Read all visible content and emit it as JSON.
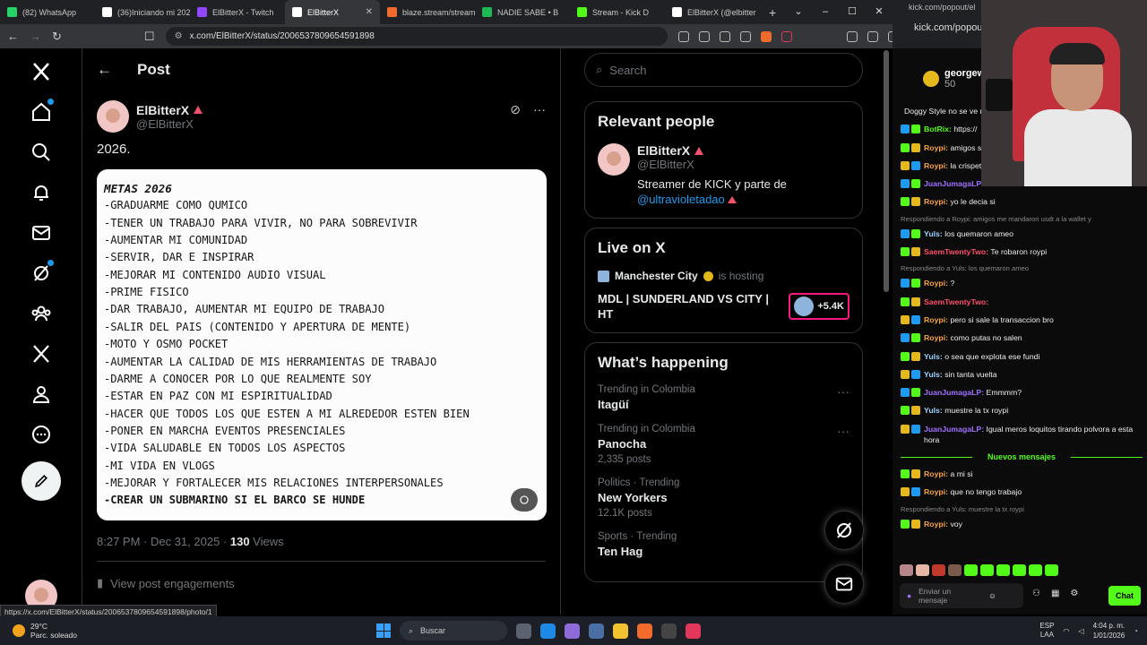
{
  "browser": {
    "tabs": [
      {
        "title": "(82) WhatsApp",
        "color": "#25d366",
        "active": false
      },
      {
        "title": "(36)Iniciando mi 202",
        "color": "#ffffff",
        "active": false
      },
      {
        "title": "ElBitterX - Twitch",
        "color": "#9146ff",
        "active": false
      },
      {
        "title": "ElBitterX",
        "color": "#ffffff",
        "active": true
      },
      {
        "title": "blaze.stream/stream",
        "color": "#f16a2d",
        "active": false
      },
      {
        "title": "NADIE SABE • B",
        "color": "#1db954",
        "active": false
      },
      {
        "title": "Stream - Kick D",
        "color": "#53fc18",
        "active": false
      },
      {
        "title": "ElBitterX (@elbitter",
        "color": "#ffffff",
        "active": false
      }
    ],
    "address": "x.com/ElBitterX/status/2006537809654591898",
    "status_url": "https://x.com/ElBitterX/status/2006537809654591898/photo/1"
  },
  "main": {
    "header_title": "Post",
    "author_name": "ElBitterX",
    "author_handle": "@ElBitterX",
    "post_text": "2026.",
    "image_title": "METAS 2026",
    "goals": [
      "-GRADUARME COMO QUMICO",
      "-TENER UN TRABAJO PARA VIVIR, NO PARA SOBREVIVIR",
      "-AUMENTAR MI COMUNIDAD",
      "-SERVIR, DAR E INSPIRAR",
      "-MEJORAR MI CONTENIDO AUDIO VISUAL",
      "-PRIME FISICO",
      "-DAR TRABAJO, AUMENTAR MI EQUIPO DE TRABAJO",
      "-SALIR DEL PAIS (CONTENIDO Y APERTURA DE MENTE)",
      "-MOTO Y OSMO POCKET",
      "-AUMENTAR LA CALIDAD DE MIS HERRAMIENTAS DE TRABAJO",
      "-DARME A CONOCER POR LO QUE REALMENTE SOY",
      "-ESTAR EN PAZ CON MI ESPIRITUALIDAD",
      "-HACER QUE TODOS LOS QUE ESTEN A MI ALREDEDOR ESTEN BIEN",
      "-PONER EN MARCHA EVENTOS PRESENCIALES",
      "-VIDA SALUDABLE EN TODOS LOS ASPECTOS",
      "-MI VIDA EN VLOGS",
      "-MEJORAR Y FORTALECER MIS RELACIONES INTERPERSONALES",
      "-CREAR UN SUBMARINO SI EL BARCO SE HUNDE"
    ],
    "timestamp": "8:27 PM · Dec 31, 2025 · ",
    "views_count": "130",
    "views_label": " Views",
    "engagements": "View post engagements"
  },
  "right": {
    "search_placeholder": "Search",
    "relevant_title": "Relevant people",
    "rp_name": "ElBitterX",
    "rp_handle": "@ElBitterX",
    "rp_bio": "Streamer de KICK y parte de ",
    "rp_link": "@ultravioletadao",
    "live_title": "Live on X",
    "live_host": "Manchester City",
    "live_hosting": "is hosting",
    "live_event": "MDL | SUNDERLAND VS CITY | HT",
    "live_count": "+5.4K",
    "happening_title": "What’s happening",
    "trends": [
      {
        "ctx": "Trending in Colombia",
        "name": "Itagüí",
        "posts": ""
      },
      {
        "ctx": "Trending in Colombia",
        "name": "Panocha",
        "posts": "2,335 posts"
      },
      {
        "ctx": "Politics · Trending",
        "name": "New Yorkers",
        "posts": "12.1K posts"
      },
      {
        "ctx": "Sports · Trending",
        "name": "Ten Hag",
        "posts": ""
      }
    ]
  },
  "kick": {
    "url_small": "kick.com/popout/el",
    "url": "kick.com/popout/",
    "user": "georgew",
    "coins": "50",
    "messages": [
      {
        "type": "msg",
        "user": "",
        "color": "#ffffff",
        "text": "Doggy Style no se ve reproductor"
      },
      {
        "type": "msg",
        "user": "BotRix:",
        "color": "#53fc18",
        "text": "https://"
      },
      {
        "type": "msg",
        "user": "Roypi:",
        "color": "#f7a440",
        "text": "amigos salen en la wallet, la b"
      },
      {
        "type": "msg",
        "user": "Roypi:",
        "color": "#f7a440",
        "text": "la crispeta"
      },
      {
        "type": "msg",
        "user": "JuanJumagaLP:",
        "color": "#a070ff",
        "text": "Los totes si mhm"
      },
      {
        "type": "msg",
        "user": "Roypi:",
        "color": "#f7a440",
        "text": "yo le decia si"
      },
      {
        "type": "reply",
        "text": "Respondiendo a Roypi: amigos me mandaron usdt a la wallet y"
      },
      {
        "type": "msg",
        "user": "Yuls:",
        "color": "#9fd3ff",
        "text": "los quemaron ameo"
      },
      {
        "type": "msg",
        "user": "SaemTwentyTwo:",
        "color": "#ff4f6b",
        "text": "Te robaron roypi"
      },
      {
        "type": "reply",
        "text": "Respondiendo a Yuls: los quemaron ameo"
      },
      {
        "type": "msg",
        "user": "Roypi:",
        "color": "#f7a440",
        "text": "?"
      },
      {
        "type": "msg",
        "user": "SaemTwentyTwo:",
        "color": "#ff4f6b",
        "text": ""
      },
      {
        "type": "msg",
        "user": "Roypi:",
        "color": "#f7a440",
        "text": "pero si sale la transaccion bro"
      },
      {
        "type": "msg",
        "user": "Roypi:",
        "color": "#f7a440",
        "text": "como putas no salen"
      },
      {
        "type": "msg",
        "user": "Yuls:",
        "color": "#9fd3ff",
        "text": "o sea que explota ese fundi"
      },
      {
        "type": "msg",
        "user": "Yuls:",
        "color": "#9fd3ff",
        "text": "sin tanta vuelta"
      },
      {
        "type": "msg",
        "user": "JuanJumagaLP:",
        "color": "#a070ff",
        "text": "Emmmm?"
      },
      {
        "type": "msg",
        "user": "Yuls:",
        "color": "#9fd3ff",
        "text": "muestre la tx roypi"
      },
      {
        "type": "msg",
        "user": "JuanJumagaLP:",
        "color": "#a070ff",
        "text": "Igual meros loquitos tirando polvora a esta hora"
      },
      {
        "type": "new",
        "text": "Nuevos mensajes"
      },
      {
        "type": "msg",
        "user": "Roypi:",
        "color": "#f7a440",
        "text": "a mi si"
      },
      {
        "type": "msg",
        "user": "Roypi:",
        "color": "#f7a440",
        "text": "que no tengo trabajo"
      },
      {
        "type": "reply",
        "text": "Respondiendo a Yuls: muestre la tx roypi"
      },
      {
        "type": "msg",
        "user": "Roypi:",
        "color": "#f7a440",
        "text": "voy"
      }
    ],
    "input_placeholder": "Enviar un mensaje",
    "chat_button": "Chat"
  },
  "taskbar": {
    "temp": "29°C",
    "weather": "Parc. soleado",
    "search": "Buscar",
    "lang1": "ESP",
    "lang2": "LAA",
    "time": "4:04 p. m.",
    "date": "1/01/2026"
  }
}
